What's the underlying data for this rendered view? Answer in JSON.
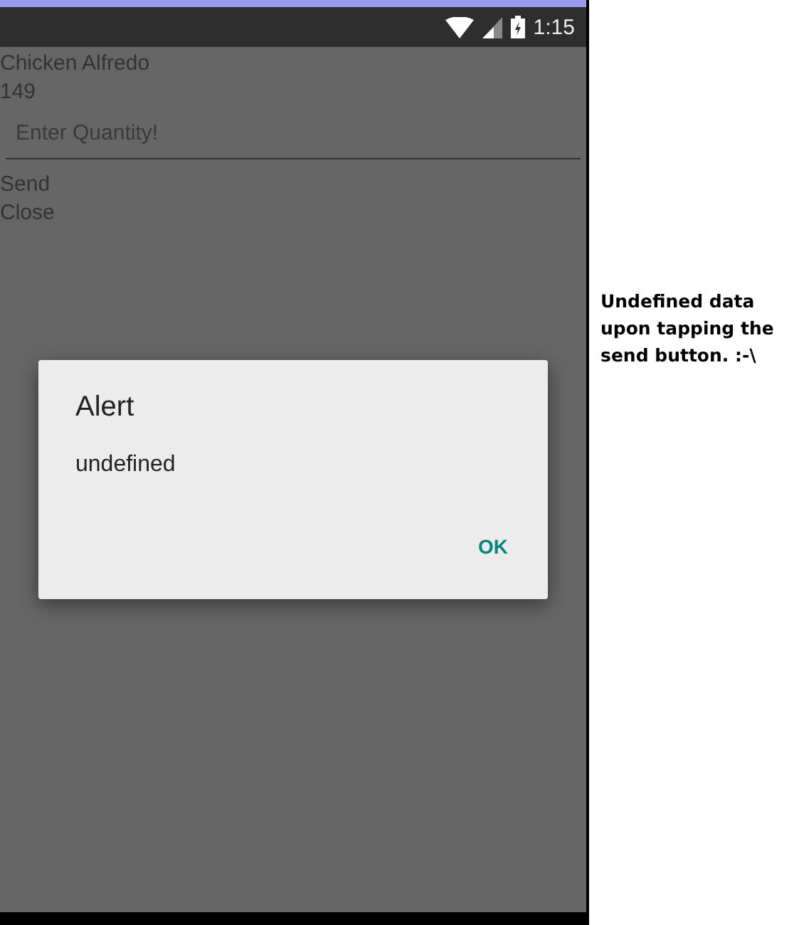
{
  "status_bar": {
    "time": "1:15"
  },
  "screen": {
    "dish_name": "Chicken Alfredo",
    "price": "149",
    "quantity_field": {
      "placeholder": "Enter Quantity!"
    },
    "buttons": [
      "Send",
      "Close"
    ]
  },
  "dialog": {
    "title": "Alert",
    "message": "undefined",
    "buttons": [
      "OK"
    ]
  },
  "annotation": "Undefined data upon tapping the send button. :-\\"
}
